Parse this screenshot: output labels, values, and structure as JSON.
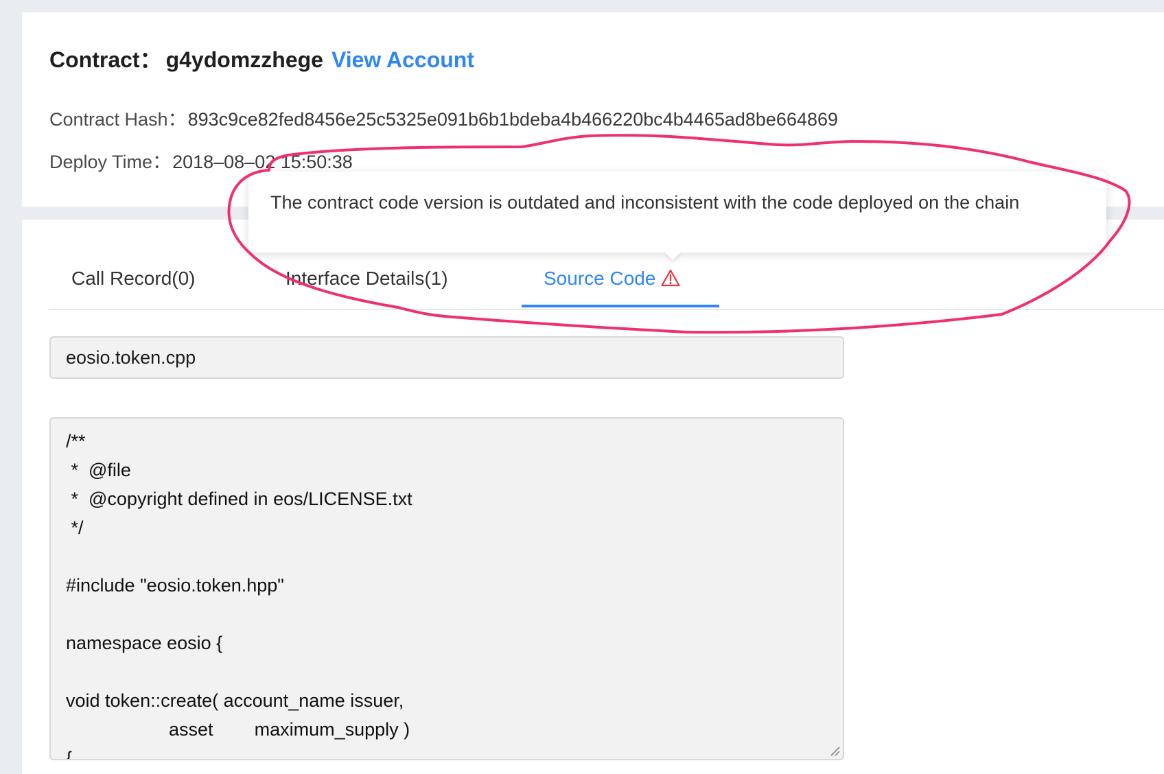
{
  "header": {
    "contract_label": "Contract：",
    "contract_name": "g4ydomzzhege",
    "view_account_link": "View Account"
  },
  "meta": {
    "hash_label": "Contract Hash：",
    "hash_value": "893c9ce82fed8456e25c5325e091b6b1bdeba4b466220bc4b4465ad8be664869",
    "deploy_label": "Deploy Time：",
    "deploy_value": "2018–08–02 15:50:38"
  },
  "tooltip": {
    "text": "The contract code version is outdated and inconsistent with the code deployed on the chain"
  },
  "tabs": [
    {
      "label": "Call Record(0)",
      "active": false
    },
    {
      "label": "Interface Details(1)",
      "active": false
    },
    {
      "label": "Source Code",
      "active": true,
      "icon": "warning-icon"
    }
  ],
  "source": {
    "selected_file": "eosio.token.cpp",
    "code": "/**\n *  @file\n *  @copyright defined in eos/LICENSE.txt\n */\n\n#include \"eosio.token.hpp\"\n\nnamespace eosio {\n\nvoid token::create( account_name issuer,\n                    asset        maximum_supply )\n{"
  },
  "colors": {
    "accent": "#2f86f6",
    "warning": "#e8323c",
    "annotation": "#f0306e"
  }
}
